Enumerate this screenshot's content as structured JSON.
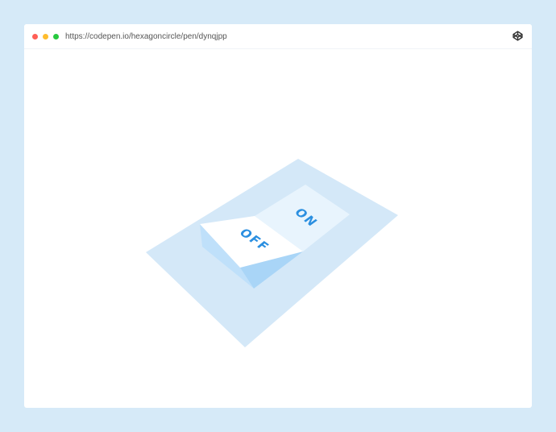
{
  "browser": {
    "url": "https://codepen.io/hexagoncircle/pen/dynqjpp",
    "controls": [
      {
        "name": "close",
        "color": "#ff5f56"
      },
      {
        "name": "minimize",
        "color": "#ffbd2e"
      },
      {
        "name": "maximize",
        "color": "#27c93f"
      }
    ],
    "brand_icon": "codepen-icon"
  },
  "toggle": {
    "off_label": "OFF",
    "on_label": "ON",
    "state": "off",
    "colors": {
      "base_plate": "#d4e8f8",
      "off_face": "#ffffff",
      "on_face": "#e8f4fd",
      "side_face": "#bfe0fa",
      "label": "#2b8fe0"
    }
  }
}
